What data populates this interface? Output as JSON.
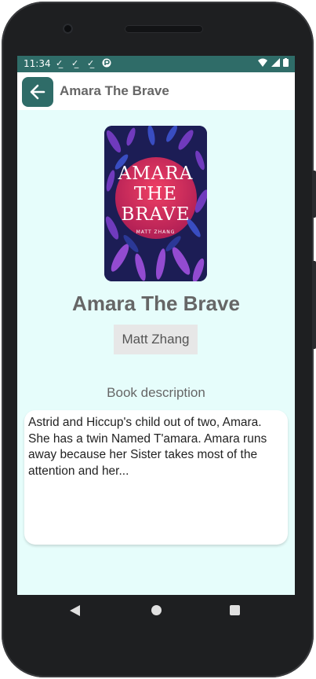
{
  "status_bar": {
    "time": "11:34",
    "notification_icons": [
      "download-done-icon",
      "download-done-icon",
      "download-done-icon",
      "play-protect-icon"
    ],
    "system_icons": [
      "wifi-icon",
      "signal-icon",
      "battery-icon"
    ]
  },
  "app_bar": {
    "back_icon": "arrow-left-icon",
    "title": "Amara The Brave"
  },
  "book": {
    "cover": {
      "title_lines": [
        "AMARA",
        "THE",
        "BRAVE"
      ],
      "author": "MATT ZHANG"
    },
    "title": "Amara The Brave",
    "author": "Matt Zhang",
    "description_label": "Book description",
    "description": "Astrid and Hiccup's child out of two, Amara. She has a twin Named T'amara. Amara runs away because her Sister takes most of the attention and her..."
  },
  "nav_bar": {
    "items": [
      "back-triangle-icon",
      "home-circle-icon",
      "recents-square-icon"
    ]
  },
  "colors": {
    "accent": "#2f6c68",
    "screen_background": "#e6fdfb",
    "title_text": "#666666"
  }
}
